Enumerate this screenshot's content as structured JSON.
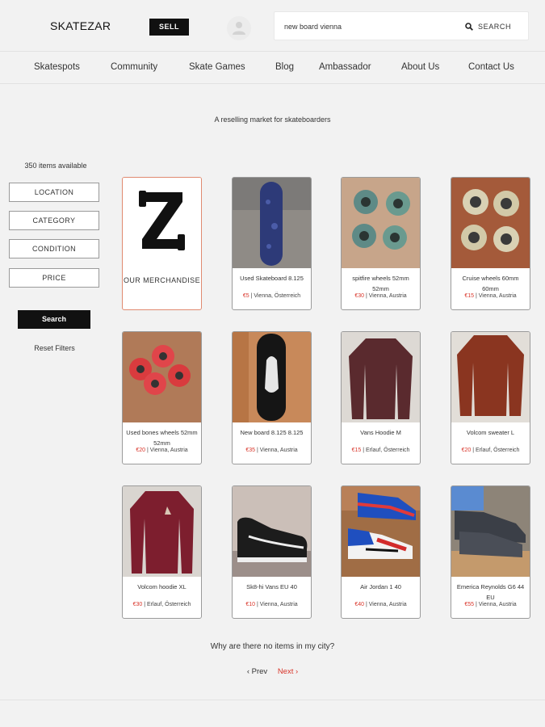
{
  "header": {
    "logo": "SKATEZAR",
    "sell_label": "SELL",
    "search_value": "new board vienna",
    "search_label": "SEARCH"
  },
  "nav": [
    "Skatespots",
    "Community",
    "Skate Games",
    "Blog",
    "Ambassador",
    "About Us",
    "Contact Us"
  ],
  "tagline": "A reselling market for skateboarders",
  "sidebar": {
    "items_count": "350 items available",
    "filters": [
      "LOCATION",
      "CATEGORY",
      "CONDITION",
      "PRICE"
    ],
    "search_label": "Search",
    "reset_label": "Reset Filters"
  },
  "merch": {
    "title": "OUR MERCHANDISE"
  },
  "products": [
    {
      "title": "Used Skateboard 8.125",
      "price": "€5",
      "location": "Vienna, Österreich",
      "image": "skateboard-deck"
    },
    {
      "title": "spitfire wheels 52mm 52mm",
      "price": "€30",
      "location": "Vienna, Austria",
      "image": "green-wheels"
    },
    {
      "title": "Cruise wheels 60mm 60mm",
      "price": "€15",
      "location": "Vienna, Austria",
      "image": "cream-wheels"
    },
    {
      "title": "Used bones wheels 52mm 52mm",
      "price": "€20",
      "location": "Vienna, Austria",
      "image": "red-wheels"
    },
    {
      "title": "New board 8.125 8.125",
      "price": "€35",
      "location": "Vienna, Austria",
      "image": "black-deck"
    },
    {
      "title": "Vans Hoodie M",
      "price": "€15",
      "location": "Erlauf, Österreich",
      "image": "maroon-hoodie"
    },
    {
      "title": "Volcom sweater L",
      "price": "€20",
      "location": "Erlauf, Österreich",
      "image": "rust-sweater"
    },
    {
      "title": "Volcom hoodie XL",
      "price": "€30",
      "location": "Erlauf, Österreich",
      "image": "red-hoodie"
    },
    {
      "title": "Sk8-hi Vans EU 40",
      "price": "€10",
      "location": "Vienna, Austria",
      "image": "vans-shoe"
    },
    {
      "title": "Air Jordan 1 40",
      "price": "€40",
      "location": "Vienna, Austria",
      "image": "jordan-shoe"
    },
    {
      "title": "Emerica Reynolds G6 44 EU",
      "price": "€55",
      "location": "Vienna, Austria",
      "image": "emerica-shoe"
    }
  ],
  "footer": {
    "why_text": "Why are there no items in my city?",
    "prev_label": "‹ Prev",
    "next_label": "Next ›"
  }
}
